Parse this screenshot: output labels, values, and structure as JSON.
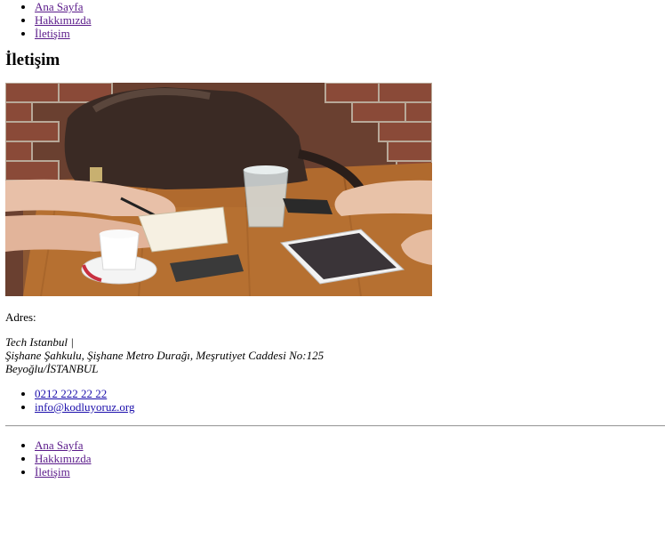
{
  "nav": {
    "items": [
      {
        "label": "Ana Sayfa"
      },
      {
        "label": "Hakkımızda"
      },
      {
        "label": "İletişim"
      }
    ]
  },
  "page": {
    "title": "İletişim"
  },
  "address": {
    "label": "Adres:",
    "company": "Tech Istanbul |",
    "line1": "Şişhane Şahkulu, Şişhane Metro Durağı, Meşrutiyet Caddesi No:125",
    "line2": "Beyoğlu/İSTANBUL"
  },
  "contact": {
    "phone": "0212 222 22 22",
    "email": "info@kodluyoruz.org"
  },
  "footer_nav": {
    "items": [
      {
        "label": "Ana Sayfa"
      },
      {
        "label": "Hakkımızda"
      },
      {
        "label": "İletişim"
      }
    ]
  }
}
